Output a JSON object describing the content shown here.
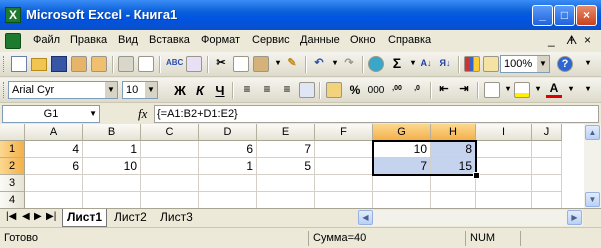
{
  "window": {
    "title": "Microsoft Excel - Книга1"
  },
  "menu": {
    "items": [
      "Файл",
      "Правка",
      "Вид",
      "Вставка",
      "Формат",
      "Сервис",
      "Данные",
      "Окно",
      "Справка"
    ],
    "underline_first": [
      true,
      true,
      true,
      true,
      true,
      true,
      true,
      true,
      true
    ]
  },
  "toolbar_standard": {
    "zoom": "100%",
    "sum_symbol": "Σ"
  },
  "toolbar_format": {
    "font": "Arial Cyr",
    "size": "10",
    "bold": "Ж",
    "italic": "К",
    "underline": "Ч",
    "percent": "%",
    "thousands": "000"
  },
  "formula_bar": {
    "name_box": "G1",
    "fx": "fx",
    "formula": "{=A1:B2+D1:E2}"
  },
  "sheet": {
    "columns": [
      "A",
      "B",
      "C",
      "D",
      "E",
      "F",
      "G",
      "H",
      "I",
      "J"
    ],
    "rows": [
      "1",
      "2",
      "3",
      "4"
    ],
    "cells": [
      [
        "4",
        "1",
        "",
        "6",
        "7",
        "",
        "10",
        "8",
        "",
        ""
      ],
      [
        "6",
        "10",
        "",
        "1",
        "5",
        "",
        "7",
        "15",
        "",
        ""
      ],
      [
        "",
        "",
        "",
        "",
        "",
        "",
        "",
        "",
        "",
        ""
      ],
      [
        "",
        "",
        "",
        "",
        "",
        "",
        "",
        "",
        "",
        ""
      ]
    ]
  },
  "tabs": [
    "Лист1",
    "Лист2",
    "Лист3"
  ],
  "status": {
    "ready": "Готово",
    "sum": "Сумма=40",
    "num": "NUM"
  },
  "colors": {
    "title_blue": "#0054e3",
    "selection_fill": "#c6d3ef",
    "header_selected": "#f4b04a"
  }
}
